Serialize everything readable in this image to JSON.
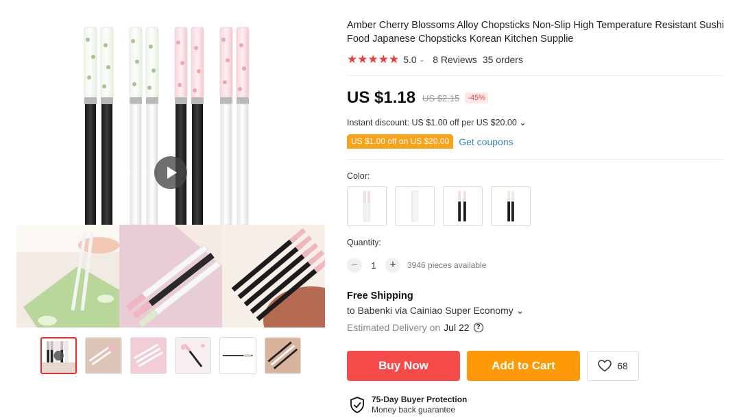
{
  "product": {
    "title": "Amber Cherry Blossoms Alloy Chopsticks Non-Slip High Temperature Resistant Sushi Food Japanese Chopsticks Korean Kitchen Supplie",
    "rating": {
      "stars": "★★★★★",
      "value": "5.0",
      "caret": "⌄",
      "reviews": "8 Reviews",
      "orders": "35 orders"
    },
    "price": {
      "current": "US $1.18",
      "original": "US $2.15",
      "discount": "-45%"
    },
    "instant_discount": "Instant discount: US $1.00 off per US $20.00 ⌄",
    "coupon": {
      "tag": "US $1.00 off on US $20.00",
      "link": "Get coupons"
    },
    "color": {
      "label": "Color:",
      "options": [
        "clear-white-pink",
        "white-clear",
        "black-pink",
        "black-clear"
      ]
    },
    "quantity": {
      "label": "Quantity:",
      "minus": "−",
      "value": "1",
      "plus": "+",
      "available": "3946 pieces available"
    },
    "shipping": {
      "title": "Free Shipping",
      "via": "to Babenki via Cainiao Super Economy ⌄",
      "delivery_label": "Estimated Delivery on",
      "delivery_date": "Jul 22",
      "help": "?"
    },
    "actions": {
      "buy_now": "Buy Now",
      "add_to_cart": "Add to Cart",
      "wishlist_count": "68"
    },
    "protection": {
      "title": "75-Day Buyer Protection",
      "subtitle": "Money back guarantee"
    }
  },
  "gallery": {
    "thumbnails": [
      "main-chopsticks",
      "chopsticks-on-tray",
      "pink-chopsticks",
      "chopstick-diagonal",
      "single-chopstick",
      "black-chopsticks"
    ],
    "active_thumbnail": 0
  },
  "colors": {
    "accent_red": "#f54b4b",
    "accent_orange": "#fd9a06",
    "star": "#e8403c",
    "link": "#3a86b9",
    "coupon": "#f9a31a"
  }
}
